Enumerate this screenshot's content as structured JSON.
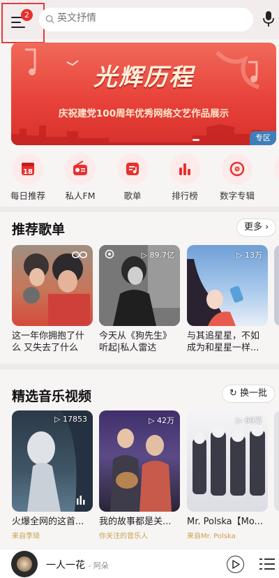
{
  "header": {
    "badge": "2",
    "search_placeholder": "英文抒情"
  },
  "banner": {
    "title": "光辉历程",
    "subtitle": "庆祝建党100周年优秀网络文艺作品展示",
    "tag": "专区"
  },
  "quick_nav": [
    {
      "label": "每日推荐",
      "icon": "calendar-icon",
      "day": "18"
    },
    {
      "label": "私人FM",
      "icon": "radio-icon"
    },
    {
      "label": "歌单",
      "icon": "playlist-icon"
    },
    {
      "label": "排行榜",
      "icon": "chart-bars-icon"
    },
    {
      "label": "数字专辑",
      "icon": "album-disc-icon"
    }
  ],
  "recommended": {
    "title": "推荐歌单",
    "more": "更多",
    "items": [
      {
        "title": "这一年你拥抱了什么 又失去了什么",
        "plays": ""
      },
      {
        "title": "今天从《狗先生》听起|私人雷达",
        "plays": "89.7亿"
      },
      {
        "title": "与其追星星，不如成为和星星一样...",
        "plays": "13万"
      }
    ]
  },
  "videos": {
    "title": "精选音乐视频",
    "refresh": "换一批",
    "items": [
      {
        "title": "火爆全网的这首...",
        "plays": "17853",
        "meta": "来自李琦"
      },
      {
        "title": "我的故事都是关...",
        "plays": "42万",
        "meta": "你关注的音乐人"
      },
      {
        "title": "Mr. Polska【Mo...",
        "plays": "69万",
        "meta": "来自Mr. Polska"
      }
    ]
  },
  "player": {
    "song": "一人一花",
    "artist": "- 阿朵"
  },
  "colors": {
    "brand_red": "#e8302d",
    "meta_gold": "#c7a24a"
  }
}
